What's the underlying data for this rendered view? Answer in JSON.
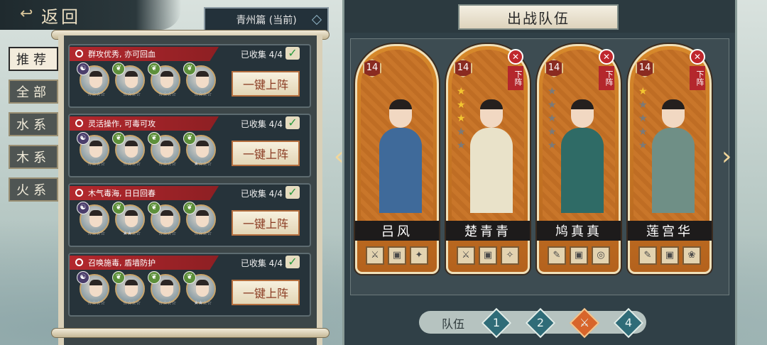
{
  "header": {
    "back_label": "返回",
    "chapter": "青州篇 (当前)"
  },
  "tabs": [
    "推荐",
    "全部",
    "水系",
    "木系",
    "火系"
  ],
  "teams": [
    {
      "tag": "群攻优秀, 亦可回血",
      "collected": "已收集 4/4",
      "deploy": "一键上阵",
      "members": [
        {
          "el": "☯",
          "stars": "☆☆☆☆"
        },
        {
          "el": "❦",
          "stars": "☆☆☆☆"
        },
        {
          "el": "❦",
          "stars": "☆☆☆☆"
        },
        {
          "el": "❦",
          "stars": "☆☆☆☆"
        }
      ]
    },
    {
      "tag": "灵活操作, 可毒可攻",
      "collected": "已收集 4/4",
      "deploy": "一键上阵",
      "members": [
        {
          "el": "☯",
          "stars": "☆☆☆☆"
        },
        {
          "el": "❦",
          "stars": "☆☆☆☆"
        },
        {
          "el": "❦",
          "stars": "☆☆☆☆"
        },
        {
          "el": "❦",
          "stars": "★☆☆☆"
        }
      ]
    },
    {
      "tag": "木气毒海, 日日回春",
      "collected": "已收集 4/4",
      "deploy": "一键上阵",
      "members": [
        {
          "el": "☯",
          "stars": "☆☆☆☆"
        },
        {
          "el": "❦",
          "stars": "★★☆☆"
        },
        {
          "el": "❦",
          "stars": "☆☆☆☆"
        },
        {
          "el": "❦",
          "stars": "☆☆☆☆"
        }
      ]
    },
    {
      "tag": "召唤施毒, 盾墙防护",
      "collected": "已收集 4/4",
      "deploy": "一键上阵",
      "members": [
        {
          "el": "☯",
          "stars": "☆☆☆☆"
        },
        {
          "el": "❦",
          "stars": "☆☆☆☆"
        },
        {
          "el": "❦",
          "stars": "☆☆☆☆"
        },
        {
          "el": "❦",
          "stars": "★★☆☆"
        }
      ]
    }
  ],
  "panel": {
    "title": "出战队伍",
    "team_label": "队伍",
    "team_buttons": [
      "1",
      "2",
      "",
      "4"
    ],
    "active_team": 3
  },
  "heroes": [
    {
      "name": "吕风",
      "level": "14",
      "stars_on": 0,
      "stars_total": 0,
      "removable": false,
      "remove_label": "",
      "equip": [
        "⚔",
        "▣",
        "✦"
      ],
      "color": "#3f6a9a"
    },
    {
      "name": "楚青青",
      "level": "14",
      "stars_on": 3,
      "stars_total": 5,
      "removable": true,
      "remove_label": "下阵",
      "equip": [
        "⚔",
        "▣",
        "✧"
      ],
      "color": "#e9e2c9"
    },
    {
      "name": "鸠真真",
      "level": "14",
      "stars_on": 0,
      "stars_total": 5,
      "removable": true,
      "remove_label": "下阵",
      "equip": [
        "✎",
        "▣",
        "◎"
      ],
      "color": "#2f6b66"
    },
    {
      "name": "莲宫华",
      "level": "14",
      "stars_on": 1,
      "stars_total": 5,
      "removable": true,
      "remove_label": "下阵",
      "equip": [
        "✎",
        "▣",
        "❀"
      ],
      "color": "#6f8f86"
    }
  ]
}
